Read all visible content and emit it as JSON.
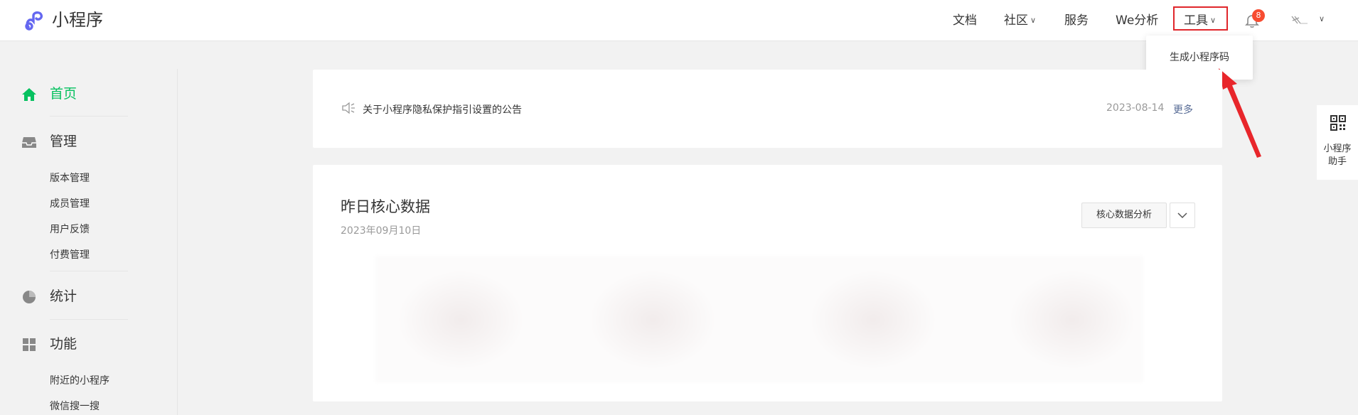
{
  "header": {
    "brand": "小程序",
    "nav": {
      "docs": "文档",
      "community": "社区",
      "service": "服务",
      "we_analysis": "We分析",
      "tools": "工具"
    },
    "notification_count": "8"
  },
  "tools_dropdown": {
    "items": [
      "生成小程序码"
    ]
  },
  "sidebar": {
    "home": "首页",
    "manage": "管理",
    "manage_items": [
      "版本管理",
      "成员管理",
      "用户反馈",
      "付费管理"
    ],
    "stats": "统计",
    "features": "功能",
    "feature_items": [
      "附近的小程序",
      "微信搜一搜"
    ]
  },
  "notice": {
    "text": "关于小程序隐私保护指引设置的公告",
    "date": "2023-08-14",
    "more": "更多"
  },
  "core_data": {
    "title": "昨日核心数据",
    "date": "2023年09月10日",
    "analysis_button": "核心数据分析"
  },
  "helper": {
    "line1": "小程序",
    "line2": "助手"
  },
  "colors": {
    "accent": "#07c160",
    "highlight_border": "#e0262b",
    "link": "#576b95",
    "badge": "#f74c31"
  }
}
